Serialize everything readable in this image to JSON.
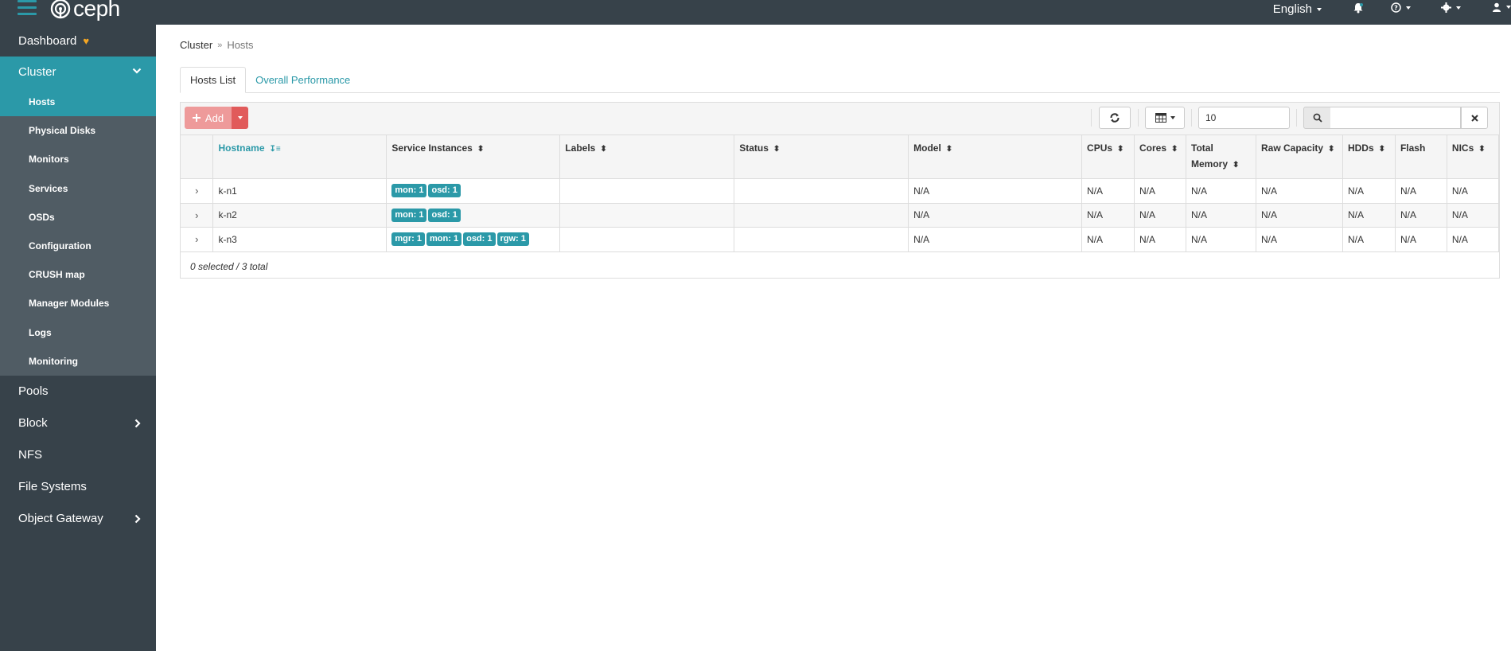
{
  "brand": {
    "name": "ceph"
  },
  "topnav": {
    "language": "English"
  },
  "sidebar": {
    "dashboard": "Dashboard",
    "cluster": "Cluster",
    "cluster_items": [
      "Hosts",
      "Physical Disks",
      "Monitors",
      "Services",
      "OSDs",
      "Configuration",
      "CRUSH map",
      "Manager Modules",
      "Logs",
      "Monitoring"
    ],
    "pools": "Pools",
    "block": "Block",
    "nfs": "NFS",
    "file_systems": "File Systems",
    "object_gateway": "Object Gateway"
  },
  "breadcrumb": {
    "parent": "Cluster",
    "current": "Hosts"
  },
  "tabs": {
    "hosts_list": "Hosts List",
    "overall_performance": "Overall Performance"
  },
  "toolbar": {
    "add_label": "Add",
    "limit_value": "10",
    "search_placeholder": ""
  },
  "table": {
    "columns": [
      "Hostname",
      "Service Instances",
      "Labels",
      "Status",
      "Model",
      "CPUs",
      "Cores",
      "Total Memory",
      "Raw Capacity",
      "HDDs",
      "Flash",
      "NICs"
    ],
    "total_memory_line1": "Total",
    "total_memory_line2": "Memory",
    "rows": [
      {
        "hostname": "k-n1",
        "services": [
          "mon: 1",
          "osd: 1"
        ],
        "model": "N/A",
        "cpus": "N/A",
        "cores": "N/A",
        "total_memory": "N/A",
        "raw_capacity": "N/A",
        "hdds": "N/A",
        "flash": "N/A",
        "nics": "N/A"
      },
      {
        "hostname": "k-n2",
        "services": [
          "mon: 1",
          "osd: 1"
        ],
        "model": "N/A",
        "cpus": "N/A",
        "cores": "N/A",
        "total_memory": "N/A",
        "raw_capacity": "N/A",
        "hdds": "N/A",
        "flash": "N/A",
        "nics": "N/A"
      },
      {
        "hostname": "k-n3",
        "services": [
          "mgr: 1",
          "mon: 1",
          "osd: 1",
          "rgw: 1"
        ],
        "model": "N/A",
        "cpus": "N/A",
        "cores": "N/A",
        "total_memory": "N/A",
        "raw_capacity": "N/A",
        "hdds": "N/A",
        "flash": "N/A",
        "nics": "N/A"
      }
    ],
    "footer": "0 selected / 3 total"
  },
  "colors": {
    "accent": "#2b99a8",
    "navbar": "#37424a",
    "sidebar_sub": "#505c64",
    "add_button": "#ee9a9a",
    "add_dropdown": "#e15b5b"
  }
}
